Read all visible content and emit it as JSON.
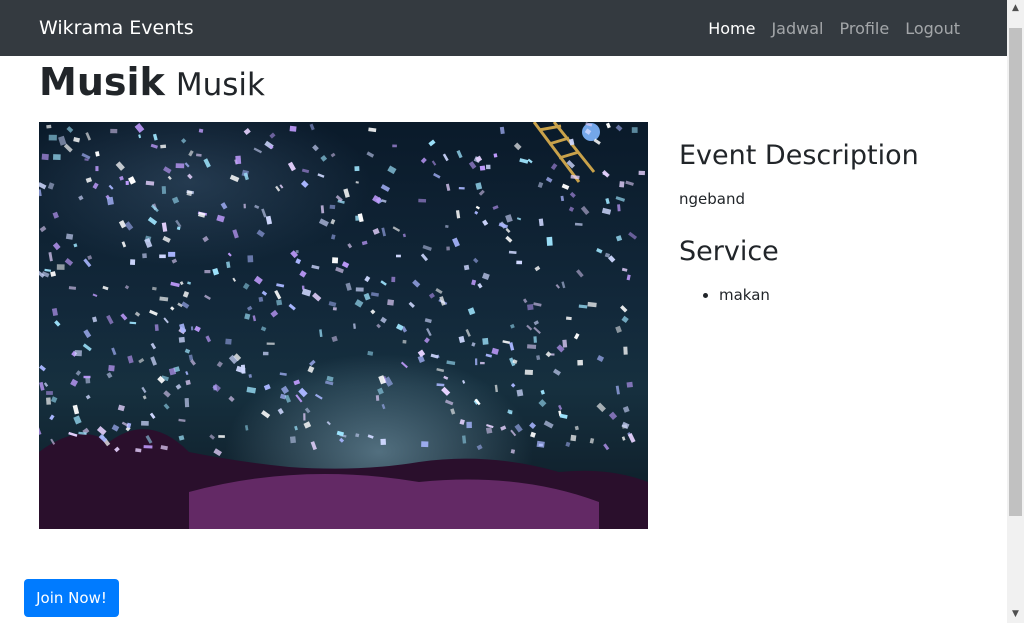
{
  "navbar": {
    "brand": "Wikrama Events",
    "links": [
      "Home",
      "Jadwal",
      "Profile",
      "Logout"
    ],
    "active": "Home"
  },
  "event": {
    "title": "Musik",
    "subtitle": "Musik",
    "image_icon": "concert-confetti-image",
    "description_heading": "Event Description",
    "description": "ngeband",
    "service_heading": "Service",
    "services": [
      "makan"
    ]
  },
  "actions": {
    "join_label": "Join Now!"
  },
  "colors": {
    "navbar_bg": "#343a40",
    "primary": "#007bff",
    "text": "#212529"
  }
}
